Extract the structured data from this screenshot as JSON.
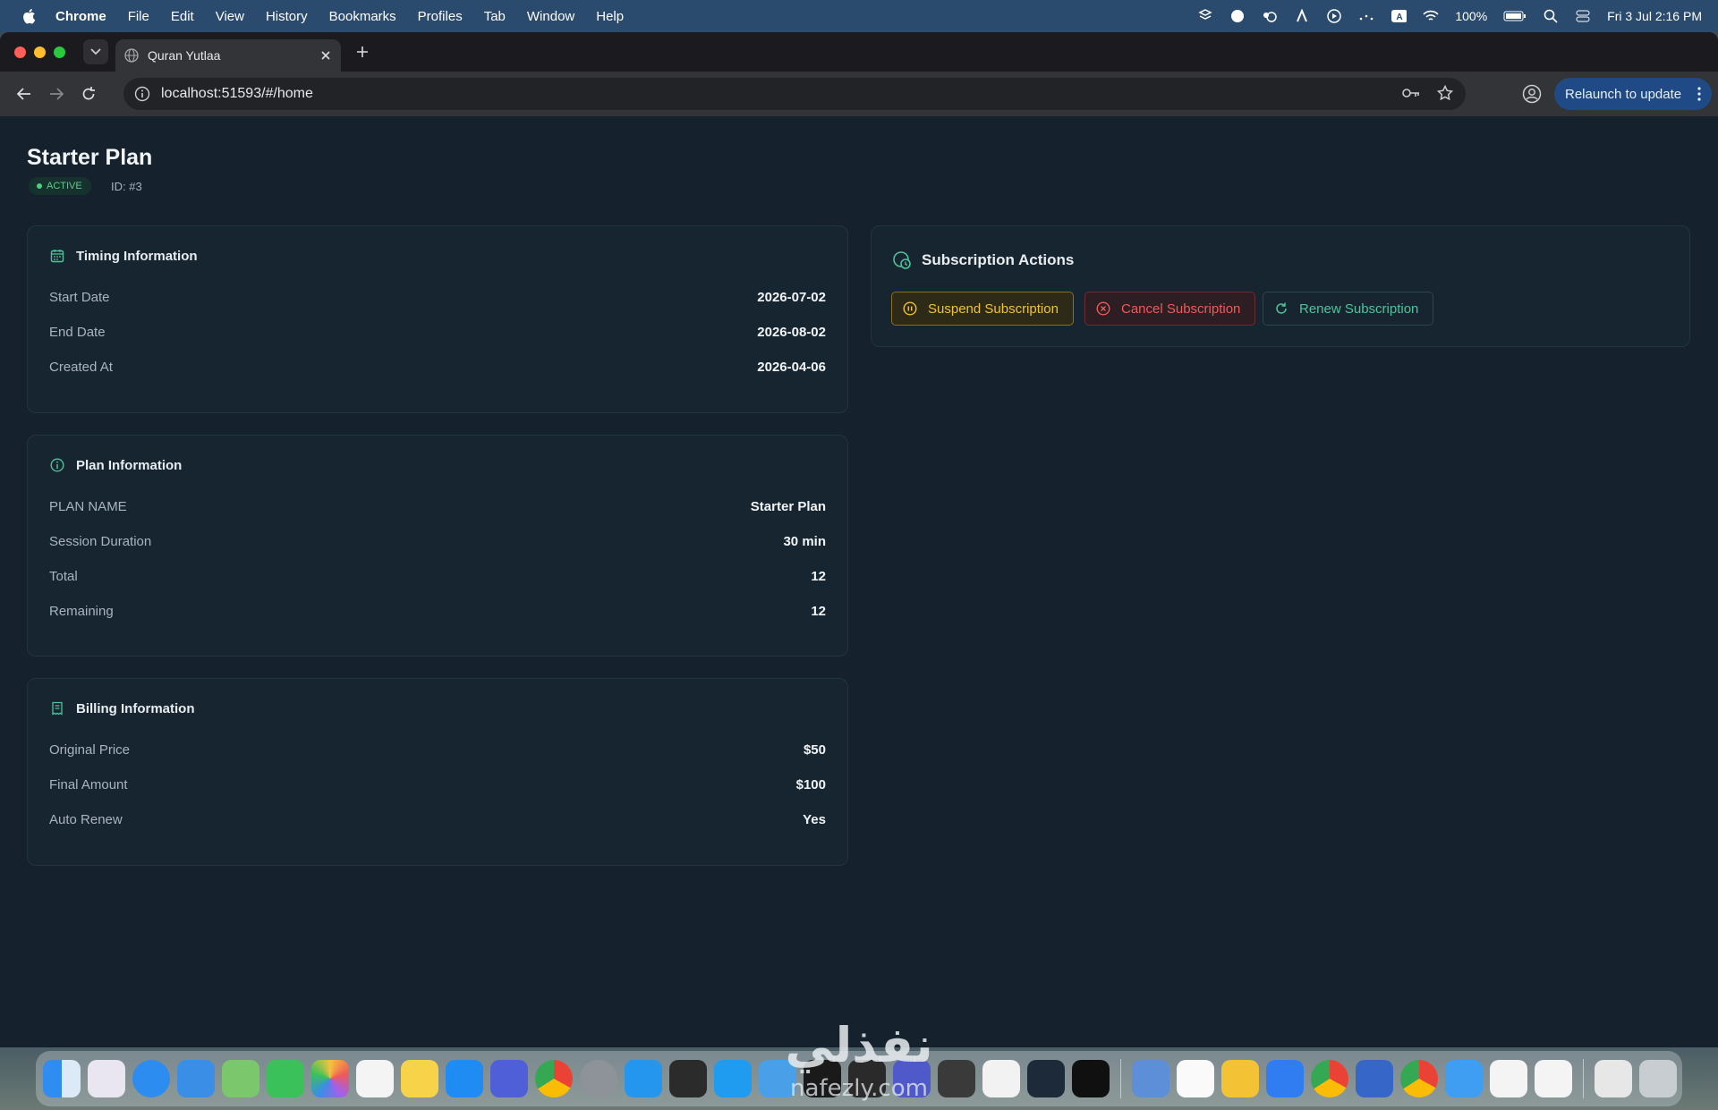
{
  "menubar": {
    "app_name": "Chrome",
    "items": [
      "File",
      "Edit",
      "View",
      "History",
      "Bookmarks",
      "Profiles",
      "Tab",
      "Window",
      "Help"
    ],
    "battery": "100%",
    "datetime": "Fri 3 Jul  2:16 PM"
  },
  "browser": {
    "tab_title": "Quran Yutlaa",
    "url": "localhost:51593/#/home",
    "relaunch_label": "Relaunch to update"
  },
  "page": {
    "title": "Starter Plan",
    "status": "ACTIVE",
    "id_label": "ID: #3"
  },
  "timing": {
    "heading": "Timing Information",
    "rows": [
      {
        "label": "Start Date",
        "value": "2026-07-02"
      },
      {
        "label": "End Date",
        "value": "2026-08-02"
      },
      {
        "label": "Created At",
        "value": "2026-04-06"
      }
    ]
  },
  "plan": {
    "heading": "Plan Information",
    "rows": [
      {
        "label": "PLAN NAME",
        "value": "Starter Plan"
      },
      {
        "label": "Session Duration",
        "value": "30 min"
      },
      {
        "label": "Total",
        "value": "12"
      },
      {
        "label": "Remaining",
        "value": "12"
      }
    ]
  },
  "billing": {
    "heading": "Billing Information",
    "rows": [
      {
        "label": "Original Price",
        "value": "$50"
      },
      {
        "label": "Final Amount",
        "value": "$100"
      },
      {
        "label": "Auto Renew",
        "value": "Yes"
      }
    ]
  },
  "actions": {
    "heading": "Subscription Actions",
    "suspend_label": "Suspend Subscription",
    "cancel_label": "Cancel Subscription",
    "renew_label": "Renew Subscription"
  },
  "colors": {
    "page_bg": "#15222d",
    "card_bg": "#172530",
    "active_green": "#5fcb8a",
    "suspend_amber": "#f0c23a",
    "cancel_red": "#ef5a5a",
    "renew_teal": "#4fc39a"
  },
  "watermark": {
    "text": "نفذلي",
    "subtext": "nafezly.com"
  }
}
